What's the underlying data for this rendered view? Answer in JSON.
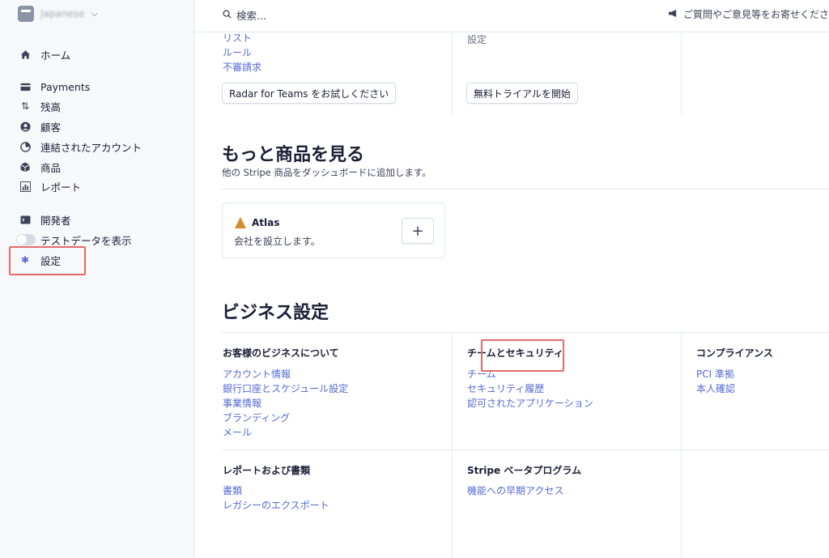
{
  "account": {
    "name": "Japanese"
  },
  "sidebar": {
    "items": [
      {
        "label": "ホーム",
        "icon": "home-icon"
      },
      {
        "label": "Payments",
        "icon": "payments-icon"
      },
      {
        "label": "残高",
        "icon": "balance-icon"
      },
      {
        "label": "顧客",
        "icon": "customers-icon"
      },
      {
        "label": "連結されたアカウント",
        "icon": "connected-accounts-icon"
      },
      {
        "label": "商品",
        "icon": "products-icon"
      },
      {
        "label": "レポート",
        "icon": "reports-icon"
      },
      {
        "label": "開発者",
        "icon": "developers-icon"
      },
      {
        "label": "テストデータを表示",
        "icon": "toggle"
      },
      {
        "label": "設定",
        "icon": "gear-icon"
      }
    ]
  },
  "topbar": {
    "search_placeholder": "検索...",
    "feedback_label": "ご質問やご意見等をお寄せくださ"
  },
  "top_section": {
    "col1_links": [
      "リスト",
      "ルール",
      "不審請求"
    ],
    "col1_button": "Radar for Teams をお試しください",
    "col2_text": "設定",
    "col2_button": "無料トライアルを開始"
  },
  "more_products": {
    "title": "もっと商品を見る",
    "subtitle": "他の Stripe 商品をダッシュボードに追加します。",
    "card": {
      "name": "Atlas",
      "desc": "会社を設立します。",
      "add": "+"
    }
  },
  "business_settings": {
    "title": "ビジネス設定",
    "columns": [
      {
        "title": "お客様のビジネスについて",
        "links": [
          "アカウント情報",
          "銀行口座とスケジュール設定",
          "事業情報",
          "ブランディング",
          "メール"
        ]
      },
      {
        "title": "チームとセキュリティ",
        "links": [
          "チーム",
          "セキュリティ履歴",
          "認可されたアプリケーション"
        ]
      },
      {
        "title": "コンプライアンス",
        "links": [
          "PCI 準拠",
          "本人確認"
        ]
      },
      {
        "title": "レポートおよび書類",
        "links": [
          "書類",
          "レガシーのエクスポート"
        ]
      },
      {
        "title": "Stripe ベータプログラム",
        "links": [
          "機能への早期アクセス"
        ]
      }
    ]
  },
  "colors": {
    "accent": "#5469d4",
    "highlight": "#e36a6a",
    "text": "#1a1f36"
  }
}
